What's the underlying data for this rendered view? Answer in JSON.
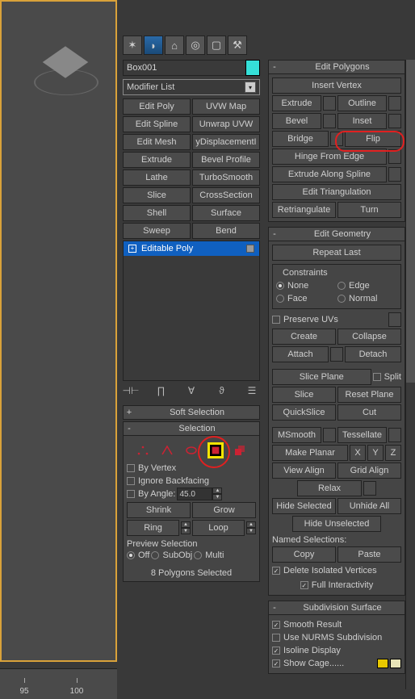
{
  "object_name": "Box001",
  "modifier_combo": "Modifier List",
  "modifier_buttons": [
    [
      "Edit Poly",
      "UVW Map"
    ],
    [
      "Edit Spline",
      "Unwrap UVW"
    ],
    [
      "Edit Mesh",
      "yDisplacementI"
    ],
    [
      "Extrude",
      "Bevel Profile"
    ],
    [
      "Lathe",
      "TurboSmooth"
    ],
    [
      "Slice",
      "CrossSection"
    ],
    [
      "Shell",
      "Surface"
    ],
    [
      "Sweep",
      "Bend"
    ]
  ],
  "stack_item": "Editable Poly",
  "soft_sel_header": "Soft Selection",
  "selection": {
    "header": "Selection",
    "by_vertex": "By Vertex",
    "ignore_backfacing": "Ignore Backfacing",
    "by_angle": "By Angle:",
    "angle_val": "45.0",
    "shrink": "Shrink",
    "grow": "Grow",
    "ring": "Ring",
    "loop": "Loop",
    "preview_label": "Preview Selection",
    "off": "Off",
    "subobj": "SubObj",
    "multi": "Multi",
    "status": "8 Polygons Selected"
  },
  "edit_polygons": {
    "header": "Edit Polygons",
    "insert_vertex": "Insert Vertex",
    "extrude": "Extrude",
    "outline": "Outline",
    "bevel": "Bevel",
    "inset": "Inset",
    "bridge": "Bridge",
    "flip": "Flip",
    "hinge": "Hinge From Edge",
    "extrude_spline": "Extrude Along Spline",
    "edit_tri": "Edit Triangulation",
    "retri": "Retriangulate",
    "turn": "Turn"
  },
  "edit_geometry": {
    "header": "Edit Geometry",
    "repeat": "Repeat Last",
    "constraints_label": "Constraints",
    "none": "None",
    "edge": "Edge",
    "face": "Face",
    "normal": "Normal",
    "preserve_uv": "Preserve UVs",
    "create": "Create",
    "collapse": "Collapse",
    "attach": "Attach",
    "detach": "Detach",
    "slice_plane": "Slice Plane",
    "split": "Split",
    "slice": "Slice",
    "reset_plane": "Reset Plane",
    "quickslice": "QuickSlice",
    "cut": "Cut",
    "msmooth": "MSmooth",
    "tessellate": "Tessellate",
    "make_planar": "Make Planar",
    "x": "X",
    "y": "Y",
    "z": "Z",
    "view_align": "View Align",
    "grid_align": "Grid Align",
    "relax": "Relax",
    "hide_sel": "Hide Selected",
    "unhide_all": "Unhide All",
    "hide_unsel": "Hide Unselected",
    "named_sel": "Named Selections:",
    "copy": "Copy",
    "paste": "Paste",
    "del_iso": "Delete Isolated Vertices",
    "full_int": "Full Interactivity"
  },
  "subdiv": {
    "header": "Subdivision Surface",
    "smooth": "Smooth Result",
    "nurms": "Use NURMS Subdivision",
    "isoline": "Isoline Display",
    "show_cage": "Show Cage......"
  },
  "ruler": {
    "a": "95",
    "b": "100"
  },
  "chart_data": null
}
